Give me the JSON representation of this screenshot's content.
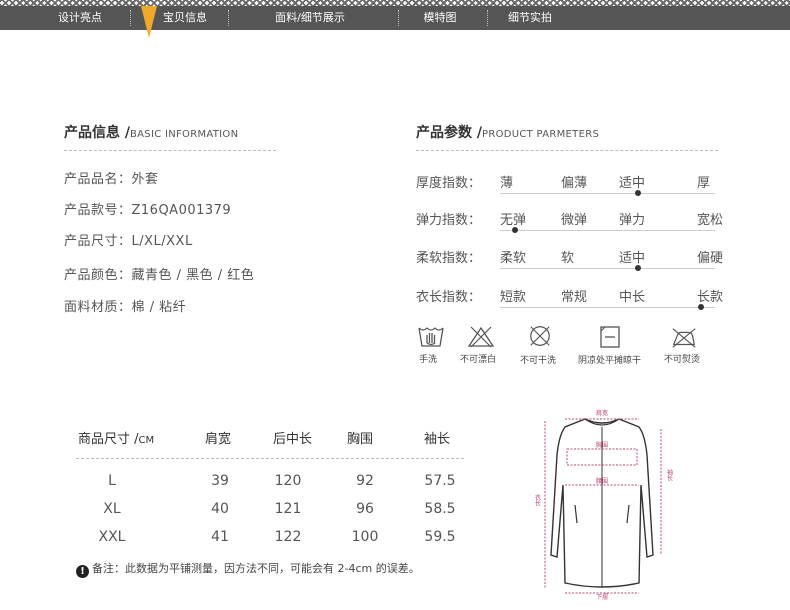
{
  "nav": {
    "items": [
      "设计亮点",
      "宝贝信息",
      "面料/细节展示",
      "模特图",
      "细节实拍"
    ],
    "active_index": 1,
    "bar_color": "#555555",
    "pointer_color": "#f0a92a"
  },
  "basic": {
    "title": "产品信息 /",
    "title_en": "BASIC INFORMATION",
    "rows": [
      "产品品名：外套",
      "产品款号：Z16QA001379",
      "产品尺寸：L/XL/XXL",
      "产品颜色：藏青色 / 黑色 / 红色",
      "面料材质：棉 / 粘纤"
    ]
  },
  "params": {
    "title": "产品参数 /",
    "title_en": "PRODUCT PARMETERS",
    "rows": [
      {
        "label": "厚度指数：",
        "options": [
          "薄",
          "偏薄",
          "适中",
          "厚"
        ],
        "selected": 2
      },
      {
        "label": "弹力指数：",
        "options": [
          "无弹",
          "微弹",
          "弹力",
          "宽松"
        ],
        "selected": 0
      },
      {
        "label": "柔软指数：",
        "options": [
          "柔软",
          "软",
          "适中",
          "偏硬"
        ],
        "selected": 2
      },
      {
        "label": "衣长指数：",
        "options": [
          "短款",
          "常规",
          "中长",
          "长款"
        ],
        "selected": 3
      }
    ]
  },
  "care": {
    "labels": [
      "手洗",
      "不可漂白",
      "不可干洗",
      "阴凉处平摊晾干",
      "不可熨烫"
    ],
    "icons": [
      "hand-wash-icon",
      "no-bleach-icon",
      "no-dry-clean-icon",
      "dry-flat-shade-icon",
      "no-iron-icon"
    ]
  },
  "size_table": {
    "headers": [
      "商品尺寸 /",
      "肩宽",
      "后中长",
      "胸围",
      "袖长"
    ],
    "unit": "CM",
    "rows": [
      [
        "L",
        "39",
        "120",
        "92",
        "57.5"
      ],
      [
        "XL",
        "40",
        "121",
        "96",
        "58.5"
      ],
      [
        "XXL",
        "41",
        "122",
        "100",
        "59.5"
      ]
    ],
    "note": "备注：此数据为平铺测量，因方法不同，可能会有 2-4cm 的误差。",
    "note_icon": "!"
  },
  "diagram": {
    "labels": {
      "shoulder": "肩宽",
      "bust": "胸围",
      "waist": "腰围",
      "hem": "下摆",
      "length": "衣长",
      "sleeve": "袖长"
    },
    "measure_color": "#c0446a"
  }
}
